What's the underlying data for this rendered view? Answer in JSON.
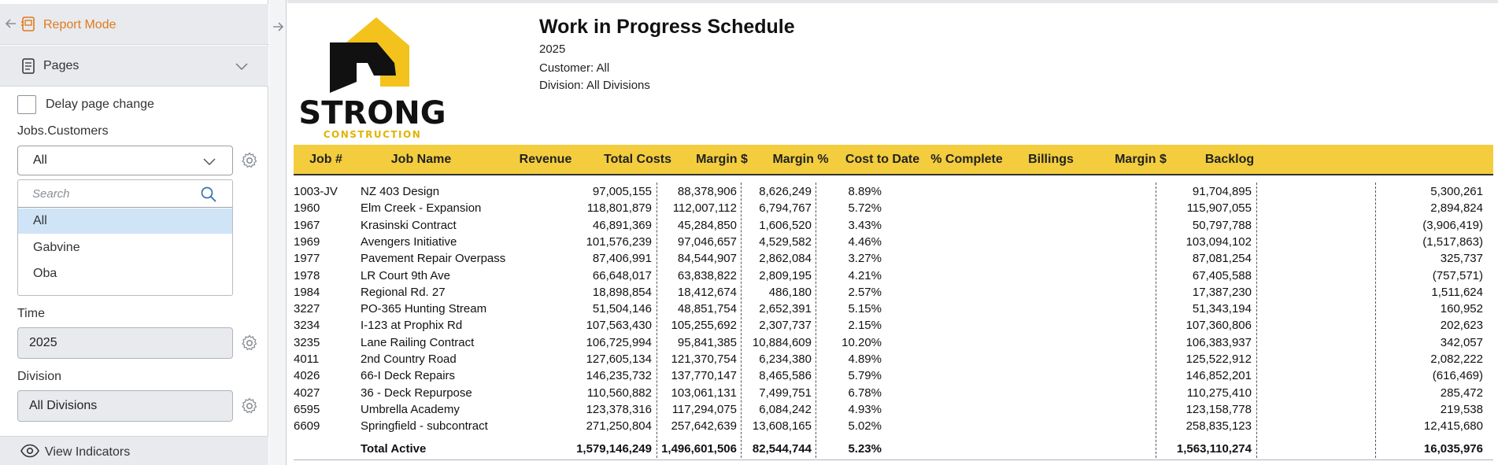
{
  "sidebar": {
    "mode_label": "Report Mode",
    "pages_label": "Pages",
    "delay_label": "Delay page change",
    "customers_label": "Jobs.Customers",
    "customers_value": "All",
    "search_placeholder": "Search",
    "customer_options": [
      {
        "label": "All",
        "selected": true
      },
      {
        "label": "Gabvine",
        "selected": false
      },
      {
        "label": "Oba",
        "selected": false
      }
    ],
    "time_label": "Time",
    "time_value": "2025",
    "division_label": "Division",
    "division_value": "All Divisions",
    "view_indicators_label": "View Indicators"
  },
  "report": {
    "logo_text": "STRONG",
    "logo_subtext": "CONSTRUCTION",
    "title": "Work in Progress Schedule",
    "year": "2025",
    "customer_line": "Customer: All",
    "division_line": "Division: All Divisions",
    "columns": [
      "Job #",
      "Job Name",
      "Revenue",
      "Total Costs",
      "Margin $",
      "Margin %",
      "Cost to Date",
      "% Complete",
      "Billings",
      "Margin $",
      "Backlog"
    ],
    "rows": [
      {
        "job": "1003-JV",
        "name": "NZ 403 Design",
        "revenue": "97,005,155",
        "costs": "88,378,906",
        "margin": "8,626,249",
        "margin_pct": "8.89%",
        "billings": "91,704,895",
        "backlog": "5,300,261"
      },
      {
        "job": "1960",
        "name": "Elm Creek - Expansion",
        "revenue": "118,801,879",
        "costs": "112,007,112",
        "margin": "6,794,767",
        "margin_pct": "5.72%",
        "billings": "115,907,055",
        "backlog": "2,894,824"
      },
      {
        "job": "1967",
        "name": "Krasinski Contract",
        "revenue": "46,891,369",
        "costs": "45,284,850",
        "margin": "1,606,520",
        "margin_pct": "3.43%",
        "billings": "50,797,788",
        "backlog": "(3,906,419)"
      },
      {
        "job": "1969",
        "name": "Avengers Initiative",
        "revenue": "101,576,239",
        "costs": "97,046,657",
        "margin": "4,529,582",
        "margin_pct": "4.46%",
        "billings": "103,094,102",
        "backlog": "(1,517,863)"
      },
      {
        "job": "1977",
        "name": "Pavement Repair Overpass",
        "revenue": "87,406,991",
        "costs": "84,544,907",
        "margin": "2,862,084",
        "margin_pct": "3.27%",
        "billings": "87,081,254",
        "backlog": "325,737"
      },
      {
        "job": "1978",
        "name": "LR Court 9th Ave",
        "revenue": "66,648,017",
        "costs": "63,838,822",
        "margin": "2,809,195",
        "margin_pct": "4.21%",
        "billings": "67,405,588",
        "backlog": "(757,571)"
      },
      {
        "job": "1984",
        "name": "Regional Rd. 27",
        "revenue": "18,898,854",
        "costs": "18,412,674",
        "margin": "486,180",
        "margin_pct": "2.57%",
        "billings": "17,387,230",
        "backlog": "1,511,624"
      },
      {
        "job": "3227",
        "name": "PO-365 Hunting Stream",
        "revenue": "51,504,146",
        "costs": "48,851,754",
        "margin": "2,652,391",
        "margin_pct": "5.15%",
        "billings": "51,343,194",
        "backlog": "160,952"
      },
      {
        "job": "3234",
        "name": "I-123 at Prophix Rd",
        "revenue": "107,563,430",
        "costs": "105,255,692",
        "margin": "2,307,737",
        "margin_pct": "2.15%",
        "billings": "107,360,806",
        "backlog": "202,623"
      },
      {
        "job": "3235",
        "name": "Lane Railing Contract",
        "revenue": "106,725,994",
        "costs": "95,841,385",
        "margin": "10,884,609",
        "margin_pct": "10.20%",
        "billings": "106,383,937",
        "backlog": "342,057"
      },
      {
        "job": "4011",
        "name": "2nd Country Road",
        "revenue": "127,605,134",
        "costs": "121,370,754",
        "margin": "6,234,380",
        "margin_pct": "4.89%",
        "billings": "125,522,912",
        "backlog": "2,082,222"
      },
      {
        "job": "4026",
        "name": "66-I Deck Repairs",
        "revenue": "146,235,732",
        "costs": "137,770,147",
        "margin": "8,465,586",
        "margin_pct": "5.79%",
        "billings": "146,852,201",
        "backlog": "(616,469)"
      },
      {
        "job": "4027",
        "name": "36 - Deck Repurpose",
        "revenue": "110,560,882",
        "costs": "103,061,131",
        "margin": "7,499,751",
        "margin_pct": "6.78%",
        "billings": "110,275,410",
        "backlog": "285,472"
      },
      {
        "job": "6595",
        "name": "Umbrella Academy",
        "revenue": "123,378,316",
        "costs": "117,294,075",
        "margin": "6,084,242",
        "margin_pct": "4.93%",
        "billings": "123,158,778",
        "backlog": "219,538"
      },
      {
        "job": "6609",
        "name": "Springfield - subcontract",
        "revenue": "271,250,804",
        "costs": "257,642,639",
        "margin": "13,608,165",
        "margin_pct": "5.02%",
        "billings": "258,835,123",
        "backlog": "12,415,680"
      }
    ],
    "total": {
      "label": "Total Active",
      "revenue": "1,579,146,249",
      "costs": "1,496,601,506",
      "margin": "82,544,744",
      "margin_pct": "5.23%",
      "billings": "1,563,110,274",
      "backlog": "16,035,976"
    }
  },
  "colors": {
    "accent_orange": "#e07b1f",
    "header_yellow": "#f3cd3d",
    "selected_option": "#cfe4f7"
  }
}
